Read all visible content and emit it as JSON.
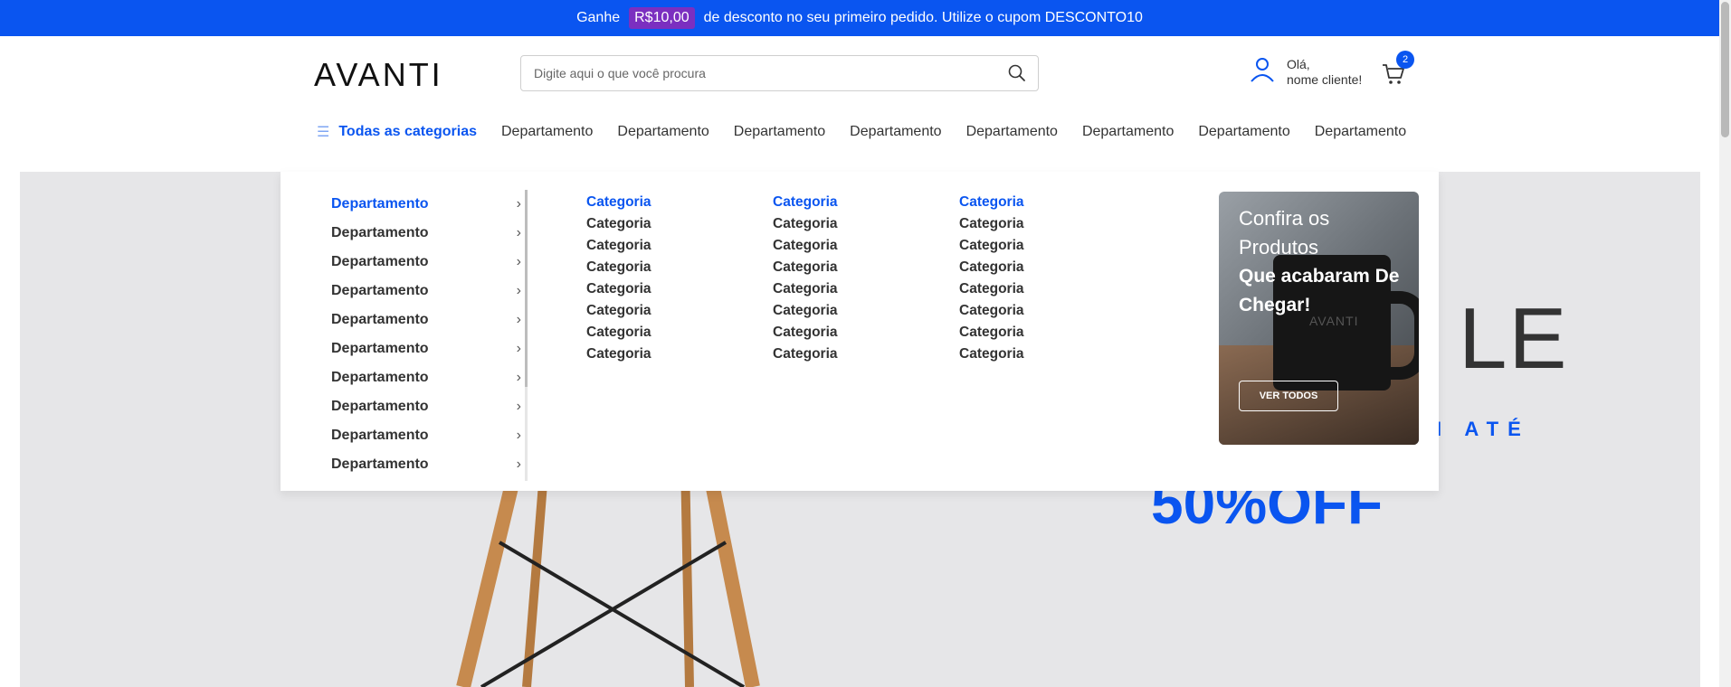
{
  "promo_bar": {
    "prefix": "Ganhe",
    "amount": "R$10,00",
    "suffix": "de desconto no seu primeiro pedido.  Utilize o cupom DESCONTO10"
  },
  "header": {
    "logo": "AVANTI",
    "search_placeholder": "Digite aqui o que você procura",
    "greeting_line1": "Olá,",
    "greeting_line2": "nome cliente!",
    "cart_count": "2"
  },
  "nav": {
    "all_categories": "Todas as categorias",
    "departments": [
      "Departamento",
      "Departamento",
      "Departamento",
      "Departamento",
      "Departamento",
      "Departamento",
      "Departamento",
      "Departamento"
    ]
  },
  "mega_menu": {
    "departments": [
      "Departamento",
      "Departamento",
      "Departamento",
      "Departamento",
      "Departamento",
      "Departamento",
      "Departamento",
      "Departamento",
      "Departamento",
      "Departamento"
    ],
    "category_columns": [
      [
        "Categoria",
        "Categoria",
        "Categoria",
        "Categoria",
        "Categoria",
        "Categoria",
        "Categoria",
        "Categoria"
      ],
      [
        "Categoria",
        "Categoria",
        "Categoria",
        "Categoria",
        "Categoria",
        "Categoria",
        "Categoria",
        "Categoria"
      ],
      [
        "Categoria",
        "Categoria",
        "Categoria",
        "Categoria",
        "Categoria",
        "Categoria",
        "Categoria",
        "Categoria"
      ]
    ],
    "promo_card": {
      "line1": "Confira os",
      "line2": "Produtos",
      "bold": "Que acabaram De Chegar!",
      "mug_brand": "AVANTI",
      "button": "VER TODOS"
    }
  },
  "hero": {
    "big_text": "LE",
    "sub_text": "I ATÉ",
    "discount": "50%OFF"
  },
  "colors": {
    "brand_blue": "#0a55f0",
    "badge_purple": "#7b2fc0"
  }
}
